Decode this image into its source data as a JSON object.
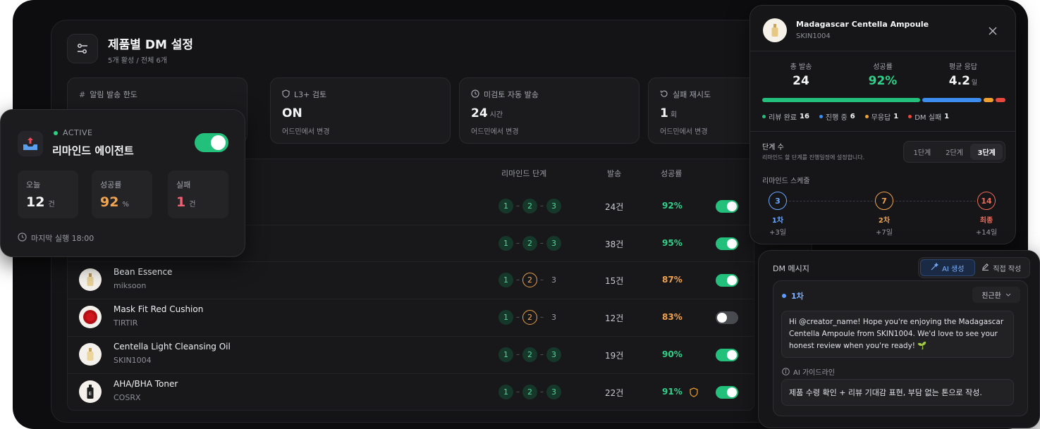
{
  "header": {
    "title": "제품별 DM 설정",
    "subtitle": "5개 활성 / 전체 6개"
  },
  "stats": [
    {
      "label": "알림 발송 한도",
      "value": "",
      "unit": "",
      "foot": "",
      "icon": "hash-icon"
    },
    {
      "label": "L3+ 검토",
      "value": "ON",
      "unit": "",
      "foot": "어드민에서 변경",
      "icon": "shield-icon"
    },
    {
      "label": "미검토 자동 발송",
      "value": "24",
      "unit": "시간",
      "foot": "어드민에서 변경",
      "icon": "clock-icon"
    },
    {
      "label": "실패 재시도",
      "value": "1",
      "unit": "회",
      "foot": "어드민에서 변경",
      "icon": "retry-icon"
    }
  ],
  "table": {
    "headers": {
      "steps": "리마인드 단계",
      "sends": "발송",
      "rate": "성공률"
    },
    "rows": [
      {
        "name": "",
        "brand": "",
        "steps": [
          "done",
          "done",
          "done"
        ],
        "labels": [
          "1",
          "2",
          "3"
        ],
        "sends": "24건",
        "rate": "92%",
        "rate_color": "#33d08a",
        "enabled": true,
        "shield": false
      },
      {
        "name": "",
        "brand": "",
        "steps": [
          "done",
          "done",
          "done"
        ],
        "labels": [
          "1",
          "2",
          "3"
        ],
        "sends": "38건",
        "rate": "95%",
        "rate_color": "#33d08a",
        "enabled": true,
        "shield": false
      },
      {
        "name": "Bean Essence",
        "brand": "miksoon",
        "steps": [
          "done",
          "cur",
          "todo"
        ],
        "labels": [
          "1",
          "2",
          "3"
        ],
        "sends": "15건",
        "rate": "87%",
        "rate_color": "#f0a24e",
        "enabled": true,
        "shield": false
      },
      {
        "name": "Mask Fit Red Cushion",
        "brand": "TIRTIR",
        "steps": [
          "done",
          "cur",
          "todo"
        ],
        "labels": [
          "1",
          "2",
          "3"
        ],
        "sends": "12건",
        "rate": "83%",
        "rate_color": "#f0a24e",
        "enabled": false,
        "shield": false
      },
      {
        "name": "Centella Light Cleansing Oil",
        "brand": "SKIN1004",
        "steps": [
          "done",
          "done",
          "done"
        ],
        "labels": [
          "1",
          "2",
          "3"
        ],
        "sends": "19건",
        "rate": "90%",
        "rate_color": "#33d08a",
        "enabled": true,
        "shield": false
      },
      {
        "name": "AHA/BHA Toner",
        "brand": "COSRX",
        "steps": [
          "done",
          "done",
          "done"
        ],
        "labels": [
          "1",
          "2",
          "3"
        ],
        "sends": "22건",
        "rate": "91%",
        "rate_color": "#33d08a",
        "enabled": true,
        "shield": true
      }
    ]
  },
  "agent": {
    "status": "ACTIVE",
    "name": "리마인드 에이전트",
    "enabled": true,
    "today_label": "오늘",
    "today_value": "12",
    "today_unit": "건",
    "rate_label": "성공률",
    "rate_value": "92",
    "rate_unit": "%",
    "fail_label": "실패",
    "fail_value": "1",
    "fail_unit": "건",
    "last_run": "마지막 실행 18:00"
  },
  "product_panel": {
    "name": "Madagascar Centella Ampoule",
    "sku": "SKIN1004",
    "total_label": "총 발송",
    "total_value": "24",
    "rate_label": "성공률",
    "rate_value": "92%",
    "avg_label": "평균 응답",
    "avg_value": "4.2",
    "avg_unit": "일",
    "breakdown": [
      {
        "label": "리뷰 완료",
        "value": "16",
        "count": 16,
        "color": "#22c07a"
      },
      {
        "label": "진행 중",
        "value": "6",
        "count": 6,
        "color": "#3d8cf0"
      },
      {
        "label": "무응답",
        "value": "1",
        "count": 1,
        "color": "#f0a02e"
      },
      {
        "label": "DM 실패",
        "value": "1",
        "count": 1,
        "color": "#e9483d"
      }
    ],
    "steps_title": "단계 수",
    "steps_desc": "리마인드 할 단계를 진행일정에 설정합니다.",
    "step_options": [
      "1단계",
      "2단계",
      "3단계"
    ],
    "step_selected": "3단계",
    "schedule_title": "리마인드 스케줄",
    "schedule": [
      {
        "day": "3",
        "label": "1차",
        "offset": "+3일",
        "color": "#6aa8ff"
      },
      {
        "day": "7",
        "label": "2차",
        "offset": "+7일",
        "color": "#f0a24e"
      },
      {
        "day": "14",
        "label": "최종",
        "offset": "+14일",
        "color": "#f06a5a"
      }
    ]
  },
  "dm": {
    "title": "DM 메시지",
    "tab_ai": "AI 생성",
    "tab_manual": "직접 작성",
    "stage_label": "1차",
    "tone": "친근한",
    "message": "Hi @creator_name! Hope you're enjoying the Madagascar Centella Ampoule from SKIN1004. We'd love to see your honest review when you're ready! 🌱",
    "guide_label": "AI 가이드라인",
    "guide_text": "제품 수령 확인 + 리뷰 기대감 표현, 부담 없는 톤으로 작성."
  }
}
